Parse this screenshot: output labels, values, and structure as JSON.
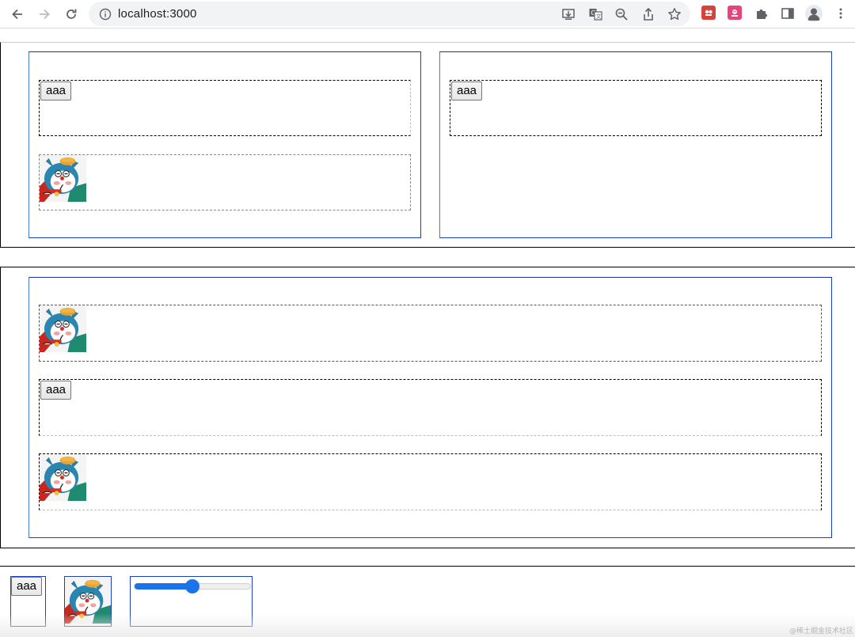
{
  "browser": {
    "url": "localhost:3000",
    "icons": {
      "back": "arrow-left-icon",
      "forward": "arrow-right-icon",
      "reload": "reload-icon",
      "info": "info-icon",
      "install": "install-app-icon",
      "translate": "translate-icon",
      "zoom": "zoom-icon",
      "share": "share-icon",
      "bookmark": "star-icon",
      "extensions": "puzzle-icon",
      "sidepanel": "side-panel-icon",
      "profile": "profile-icon",
      "menu": "more-vert-icon"
    }
  },
  "colors": {
    "panel_border": "#1a3fbf",
    "slot_border": "#000000",
    "slider_accent": "#1a73e8",
    "extension_red": "#e23b3b",
    "extension_pink": "#e8457a"
  },
  "sections": {
    "first": {
      "left_panel": {
        "button_label": "aaa",
        "image": "doraemon-sticker"
      },
      "right_panel": {
        "button_label": "aaa"
      }
    },
    "second": {
      "button_label": "aaa",
      "images": [
        "doraemon-sticker",
        "doraemon-sticker"
      ]
    }
  },
  "bottom": {
    "button_label": "aaa",
    "image": "doraemon-sticker",
    "slider_value": 0.5,
    "watermark": "@稀土掘金技术社区"
  }
}
